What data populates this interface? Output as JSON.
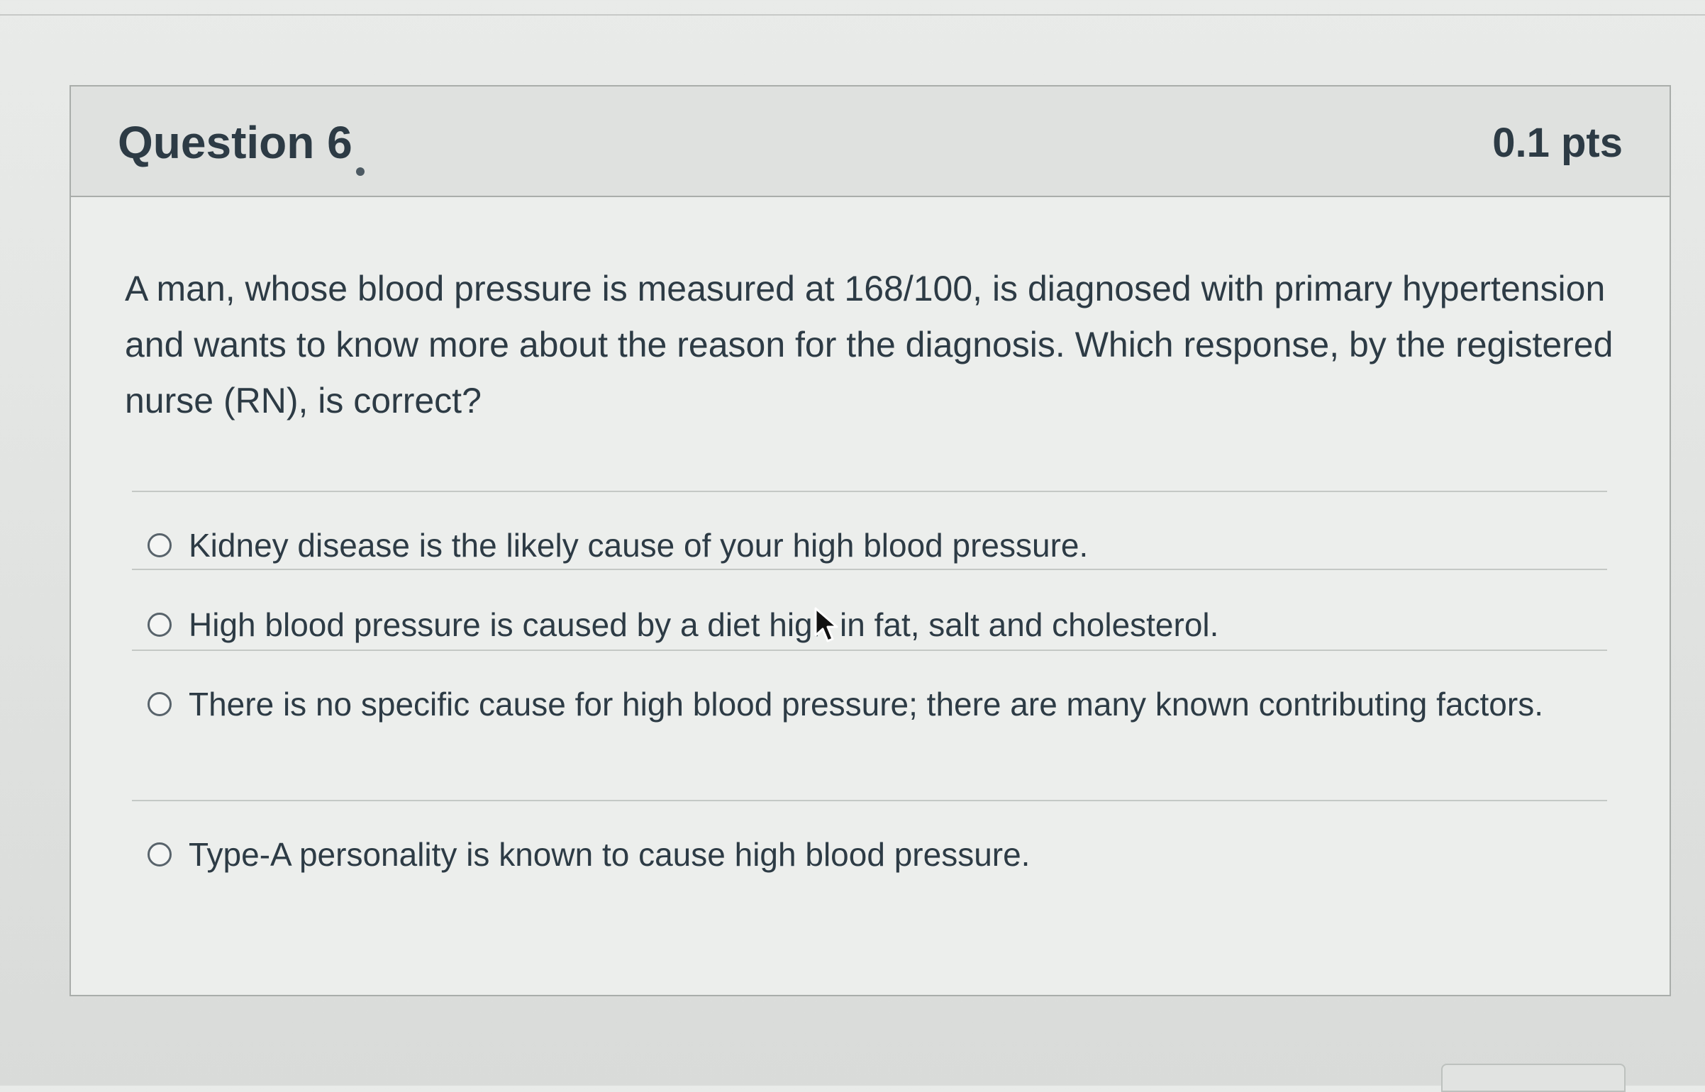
{
  "question": {
    "title": "Question 6",
    "points": "0.1 pts",
    "text": "A man, whose blood pressure is measured at 168/100, is diagnosed with primary hypertension and wants to know more about the reason for the diagnosis. Which response, by the registered nurse (RN), is correct?",
    "answers": [
      {
        "label": "Kidney disease is the likely cause of your high blood pressure.",
        "selected": false
      },
      {
        "label": "High blood pressure is caused by a diet high in fat, salt and cholesterol.",
        "selected": false
      },
      {
        "label": "There is no specific cause for high blood pressure; there are many known contributing factors.",
        "selected": false
      },
      {
        "label": "Type-A personality is known to cause high blood pressure.",
        "selected": false
      }
    ]
  },
  "icons": {
    "pointer": "mouse-pointer-icon"
  },
  "colors": {
    "text": "#2d3b45",
    "header_background": "#dfe1df",
    "border": "#a9adaa"
  }
}
